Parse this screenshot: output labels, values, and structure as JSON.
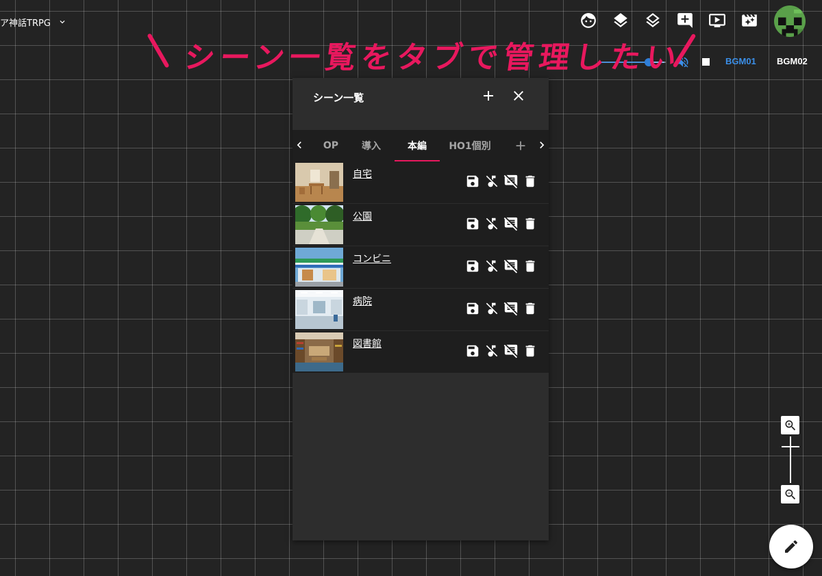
{
  "room": {
    "title": "ア神話TRPG"
  },
  "toolbar": {
    "icons": [
      "face-icon",
      "layers-icon",
      "layers-outline-icon",
      "add-comment-icon",
      "slideshow-icon",
      "movie-filter-icon"
    ]
  },
  "audio": {
    "volume_percent": 70,
    "bgm1_label": "BGM01",
    "bgm2_label": "BGM02",
    "active_color": "#3b8fe8"
  },
  "annotation": {
    "text": "シーン一覧をタブで管理したい"
  },
  "panel": {
    "title": "シーン一覧",
    "tabs": [
      {
        "label": "OP"
      },
      {
        "label": "導入"
      },
      {
        "label": "本編"
      },
      {
        "label": "HO1個別"
      }
    ],
    "active_tab": "本編",
    "scenes": [
      {
        "name": "自宅",
        "thumb": "living-room"
      },
      {
        "name": "公園",
        "thumb": "park"
      },
      {
        "name": "コンビニ",
        "thumb": "convenience-store"
      },
      {
        "name": "病院",
        "thumb": "hospital"
      },
      {
        "name": "図書館",
        "thumb": "library"
      }
    ]
  },
  "colors": {
    "accent": "#e8185e",
    "panel_bg": "#2d2d2d",
    "row_bg": "#1e1e1e"
  }
}
